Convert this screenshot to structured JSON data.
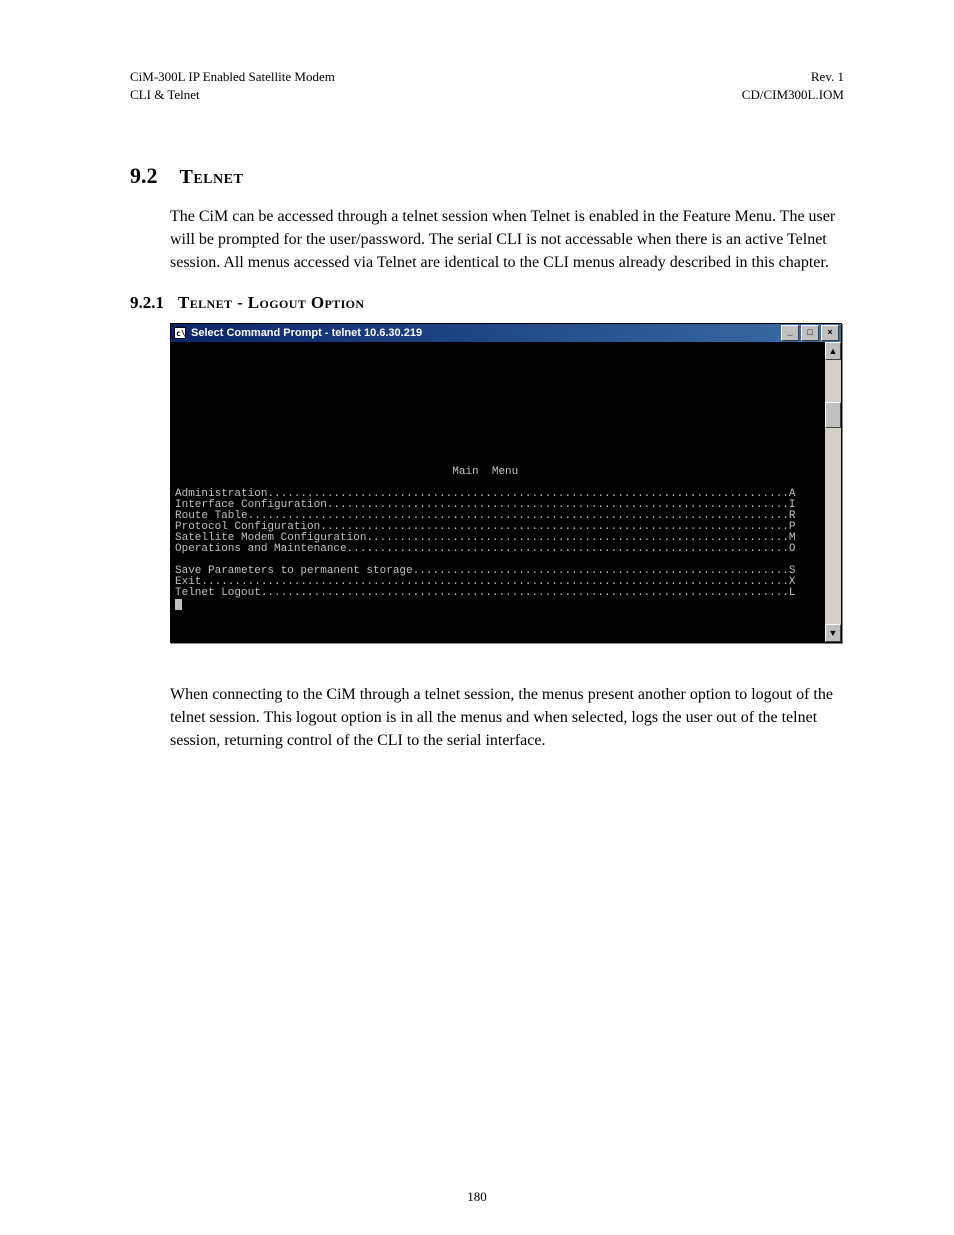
{
  "header": {
    "left_line1": "CiM-300L IP Enabled Satellite Modem",
    "left_line2": "CLI & Telnet",
    "right_line1": "Rev. 1",
    "right_line2": "CD/CIM300L.IOM"
  },
  "section": {
    "number": "9.2",
    "title": "Telnet",
    "paragraph": "The CiM can be accessed through a telnet session when Telnet is enabled in the Feature Menu. The user will be prompted for the user/password. The serial CLI is not accessable when there is an active Telnet session. All menus accessed via Telnet are identical to the CLI menus already described in this chapter."
  },
  "subsection": {
    "number": "9.2.1",
    "title": "Telnet - Logout Option",
    "paragraph": "When connecting to the CiM through a telnet session, the menus present another option to logout of the telnet session.  This logout option is in all the menus and when selected, logs the user out of the telnet session, returning control of the CLI to the serial interface."
  },
  "terminal": {
    "window_title": "Select Command Prompt - telnet 10.6.30.219",
    "controls": {
      "minimize": "_",
      "maximize": "□",
      "close": "×",
      "scroll_up": "▲",
      "scroll_down": "▼"
    },
    "menu_title": "Main  Menu",
    "menu_items_a": [
      {
        "label": "Administration",
        "key": "A"
      },
      {
        "label": "Interface Configuration",
        "key": "I"
      },
      {
        "label": "Route Table",
        "key": "R"
      },
      {
        "label": "Protocol Configuration",
        "key": "P"
      },
      {
        "label": "Satellite Modem Configuration",
        "key": "M"
      },
      {
        "label": "Operations and Maintenance",
        "key": "O"
      }
    ],
    "menu_items_b": [
      {
        "label": "Save Parameters to permanent storage",
        "key": "S"
      },
      {
        "label": "Exit",
        "key": "X"
      },
      {
        "label": "Telnet Logout",
        "key": "L"
      }
    ]
  },
  "page_number": "180"
}
